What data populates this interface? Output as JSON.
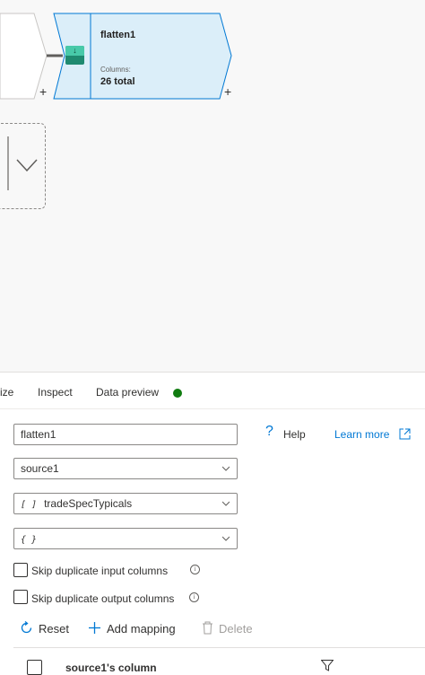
{
  "canvas": {
    "node": {
      "title": "flatten1",
      "columns_label": "Columns:",
      "columns_value": "26 total",
      "icon": "flatten-transform-icon"
    },
    "add_symbol": "+",
    "colors": {
      "node_fill": "#dbeef9",
      "node_border": "#0078d4"
    }
  },
  "tabs": {
    "optimize": "ize",
    "inspect": "Inspect",
    "data_preview": "Data preview",
    "status_color": "#107c10"
  },
  "form": {
    "name_value": "flatten1",
    "help_label": "Help",
    "learn_more": "Learn more",
    "incoming_stream": "source1",
    "unroll_by_prefix": "[ ]",
    "unroll_by": "tradeSpecTypicals",
    "unroll_root_prefix": "{ }",
    "unroll_root": "",
    "skip_input_label": "Skip duplicate input columns",
    "skip_output_label": "Skip duplicate output columns",
    "skip_input_checked": false,
    "skip_output_checked": false
  },
  "actions": {
    "reset": "Reset",
    "add_mapping": "Add mapping",
    "delete": "Delete"
  },
  "table": {
    "column_header": "source1's column"
  },
  "accent": "#0078d4"
}
